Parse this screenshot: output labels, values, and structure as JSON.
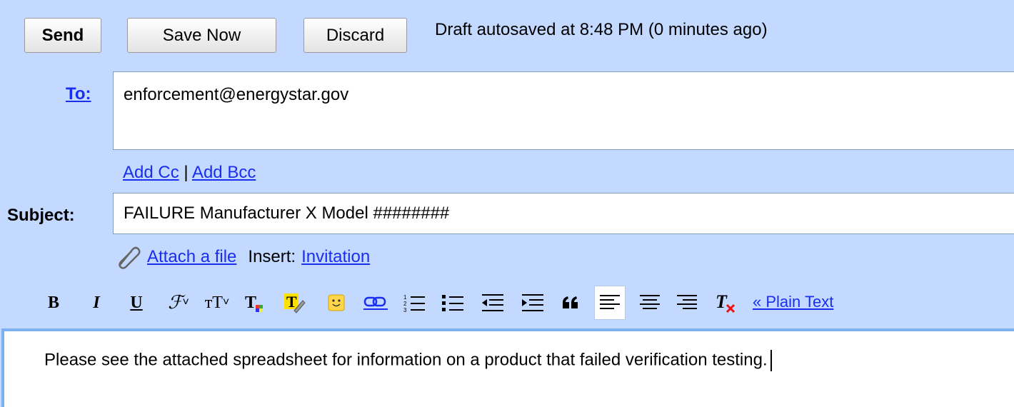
{
  "toolbar": {
    "send_label": "Send",
    "save_label": "Save Now",
    "discard_label": "Discard",
    "autosave_text": "Draft autosaved at 8:48 PM (0 minutes ago)"
  },
  "to": {
    "label": "To:",
    "value": "enforcement@energystar.gov"
  },
  "cc": {
    "add_cc": "Add Cc",
    "separator": " | ",
    "add_bcc": "Add Bcc"
  },
  "subject": {
    "label": "Subject:",
    "value": "FAILURE Manufacturer X Model ########"
  },
  "attach": {
    "attach_label": "Attach a file",
    "insert_label": "Insert:",
    "invitation_label": "Invitation"
  },
  "format": {
    "bold": "B",
    "italic": "I",
    "underline": "U",
    "font": "ℱ",
    "font_arrow": "˅",
    "size": "тT",
    "size_arrow": "˅",
    "plain_text": "« Plain Text"
  },
  "editor": {
    "body": "Please see the attached spreadsheet for information on a product that failed verification testing."
  },
  "icons": [
    "paperclip-icon",
    "bold-icon",
    "italic-icon",
    "underline-icon",
    "font-icon",
    "font-size-icon",
    "text-color-icon",
    "highlight-icon",
    "emoticon-icon",
    "link-icon",
    "numbered-list-icon",
    "bullet-list-icon",
    "indent-less-icon",
    "indent-more-icon",
    "quote-icon",
    "align-left-icon",
    "align-center-icon",
    "align-right-icon",
    "remove-formatting-icon"
  ],
  "colors": {
    "background": "#c3d9ff",
    "link": "#1a2ef0",
    "editor_border": "#7fb0f0"
  }
}
